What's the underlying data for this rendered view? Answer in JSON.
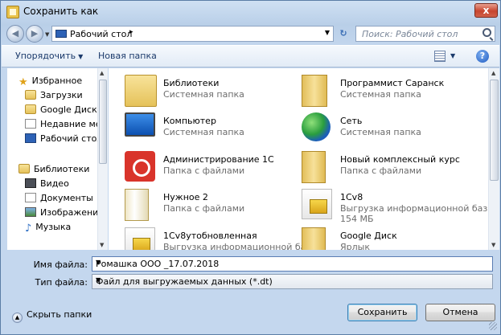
{
  "window": {
    "title": "Сохранить как",
    "close_label": "x"
  },
  "address": {
    "location": "Рабочий стол",
    "arrow": "▸"
  },
  "search": {
    "placeholder": "Поиск: Рабочий стол"
  },
  "toolbar": {
    "organize": "Упорядочить",
    "new_folder": "Новая папка",
    "help": "?"
  },
  "sidebar": {
    "items": [
      {
        "label": "Избранное",
        "icon": "star-icon"
      },
      {
        "label": "Загрузки",
        "icon": "downloads-folder-icon"
      },
      {
        "label": "Google Диск",
        "icon": "google-drive-icon"
      },
      {
        "label": "Недавние мест",
        "icon": "recent-places-icon"
      },
      {
        "label": "Рабочий стол",
        "icon": "desktop-icon"
      },
      {
        "label": "Библиотеки",
        "icon": "libraries-icon"
      },
      {
        "label": "Видео",
        "icon": "video-icon"
      },
      {
        "label": "Документы",
        "icon": "documents-icon"
      },
      {
        "label": "Изображения",
        "icon": "pictures-icon"
      },
      {
        "label": "Музыка",
        "icon": "music-icon"
      }
    ]
  },
  "files": [
    {
      "name": "Библиотеки",
      "type": "Системная папка",
      "icon": "libraries-folder-icon"
    },
    {
      "name": "Программист Саранск",
      "type": "Системная папка",
      "icon": "user-folder-icon"
    },
    {
      "name": "Компьютер",
      "type": "Системная папка",
      "icon": "computer-icon"
    },
    {
      "name": "Сеть",
      "type": "Системная папка",
      "icon": "network-icon"
    },
    {
      "name": "Администрирование 1С",
      "type": "Папка с файлами",
      "icon": "1c-icon"
    },
    {
      "name": "Новый комплексный курс",
      "type": "Папка с файлами",
      "icon": "folder-icon"
    },
    {
      "name": "Нужное 2",
      "type": "Папка с файлами",
      "icon": "folder-icon"
    },
    {
      "name": "1Cv8",
      "type": "Выгрузка информационной баз...",
      "size": "154 МБ",
      "icon": "dt-file-icon"
    },
    {
      "name": "1Cv8утобновленная",
      "type": "Выгрузка информационной баз...",
      "icon": "dt-file-icon"
    },
    {
      "name": "Google Диск",
      "type": "Ярлык",
      "icon": "shortcut-folder-icon"
    }
  ],
  "form": {
    "filename_label": "Имя файла:",
    "filename_value": "Ромашка ООО _17.07.2018",
    "filetype_label": "Тип файла:",
    "filetype_value": "Файл для выгружаемых данных (*.dt)"
  },
  "footer": {
    "hide_folders": "Скрыть папки",
    "save": "Сохранить",
    "cancel": "Отмена"
  }
}
